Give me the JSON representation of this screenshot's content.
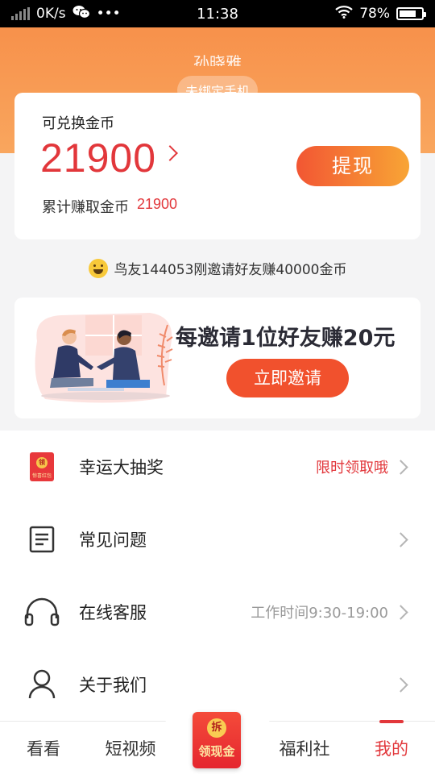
{
  "status_bar": {
    "network_speed": "0K/s",
    "dots": "•••",
    "time": "11:38",
    "battery": "78%",
    "battery_level": 0.78
  },
  "header": {
    "username": "孙晓雅",
    "bind_phone": "未绑定手机"
  },
  "coin_card": {
    "label": "可兑换金币",
    "amount": "21900",
    "withdraw_label": "提现",
    "total_label": "累计赚取金币",
    "total_value": "21900"
  },
  "ticker": {
    "text": "鸟友144053刚邀请好友赚40000金币"
  },
  "banner": {
    "title": "每邀请1位好友赚20元",
    "button_label": "立即邀请"
  },
  "menu": {
    "items": [
      {
        "label": "幸运大抽奖",
        "right": "限时领取哦",
        "icon": "red-envelope-icon"
      },
      {
        "label": "常见问题",
        "right": "",
        "icon": "document-icon"
      },
      {
        "label": "在线客服",
        "right": "工作时间9:30-19:00",
        "icon": "headphones-icon"
      },
      {
        "label": "关于我们",
        "right": "",
        "icon": "user-icon"
      }
    ],
    "lucky_icon_seal": "领",
    "lucky_icon_text": "惊喜红包"
  },
  "tab_bar": {
    "tabs": [
      "看看",
      "短视频",
      "领现金",
      "福利社",
      "我的"
    ],
    "center_seal": "拆",
    "active": "我的"
  },
  "colors": {
    "accent_red": "#e2373b",
    "header_orange": "#f7914b",
    "button_gradient_start": "#f25633",
    "button_gradient_end": "#f8a535"
  }
}
